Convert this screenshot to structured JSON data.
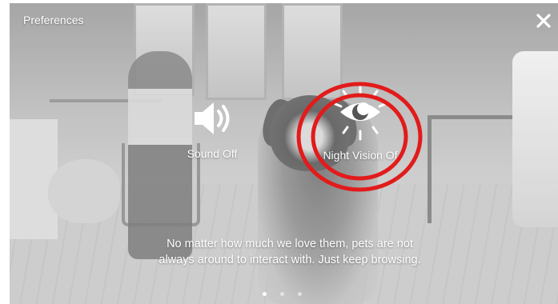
{
  "header": {
    "title": "Preferences"
  },
  "icons": {
    "close": "close-icon",
    "sound": "speaker-icon",
    "night_vision": "eye-moon-icon"
  },
  "preferences": [
    {
      "label": "Sound Off"
    },
    {
      "label": "Night Vision Of"
    }
  ],
  "annotation": {
    "color": "#e21b1b",
    "shape": "double-circle"
  },
  "message": {
    "line1": "No matter how much we love them, pets are not",
    "line2": "always around to interact with. Just keep browsing."
  },
  "pagination": {
    "total": 3,
    "current": 1
  }
}
